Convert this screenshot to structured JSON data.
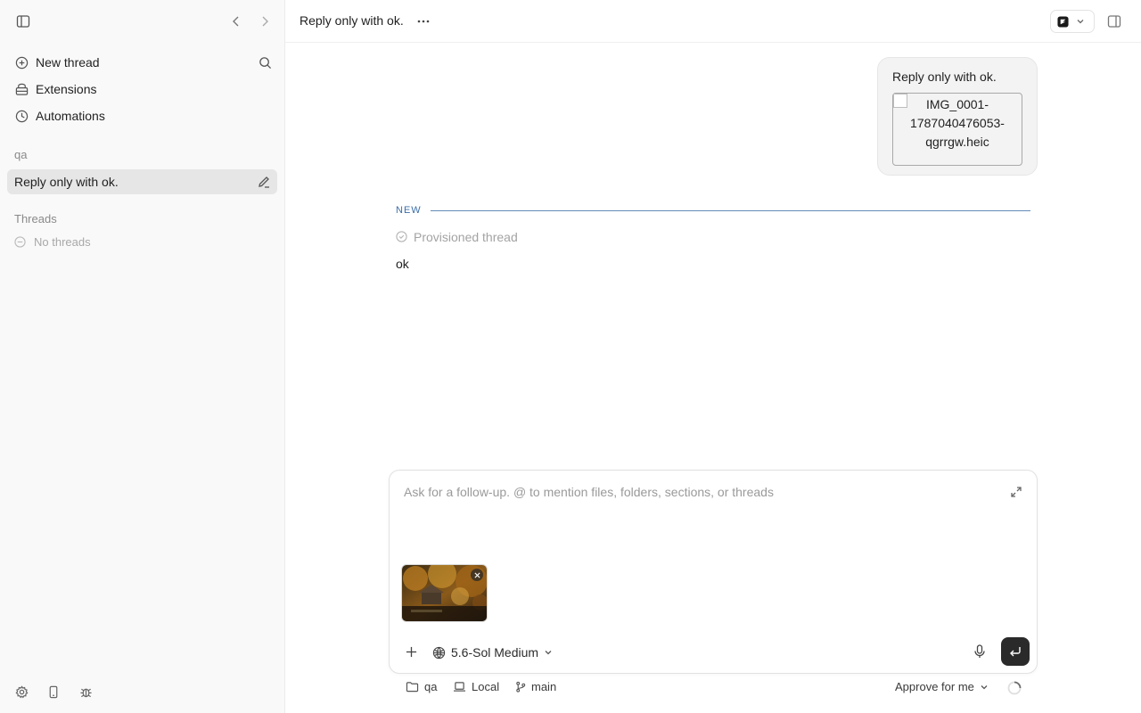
{
  "sidebar": {
    "nav": [
      {
        "label": "New thread",
        "icon": "plus-circle-icon"
      },
      {
        "label": "Extensions",
        "icon": "extensions-icon"
      },
      {
        "label": "Automations",
        "icon": "clock-icon"
      }
    ],
    "project_label": "qa",
    "active_thread": "Reply only with ok.",
    "threads_label": "Threads",
    "no_threads": "No threads"
  },
  "topbar": {
    "title": "Reply only with ok."
  },
  "conversation": {
    "user_message": "Reply only with ok.",
    "attachment_alt": "IMG_0001-1787040476053-qgrrgw.heic",
    "new_label": "NEW",
    "status": "Provisioned thread",
    "assistant_reply": "ok"
  },
  "composer": {
    "placeholder": "Ask for a follow-up. @ to mention files, folders, sections, or threads",
    "model": "5.6-Sol Medium"
  },
  "footer": {
    "folder": "qa",
    "environment": "Local",
    "branch": "main",
    "approval": "Approve for me"
  },
  "colors": {
    "accent_divider": "#3b6ea8",
    "send_button": "#2a2a2a",
    "active_item": "#e6e6e6"
  }
}
